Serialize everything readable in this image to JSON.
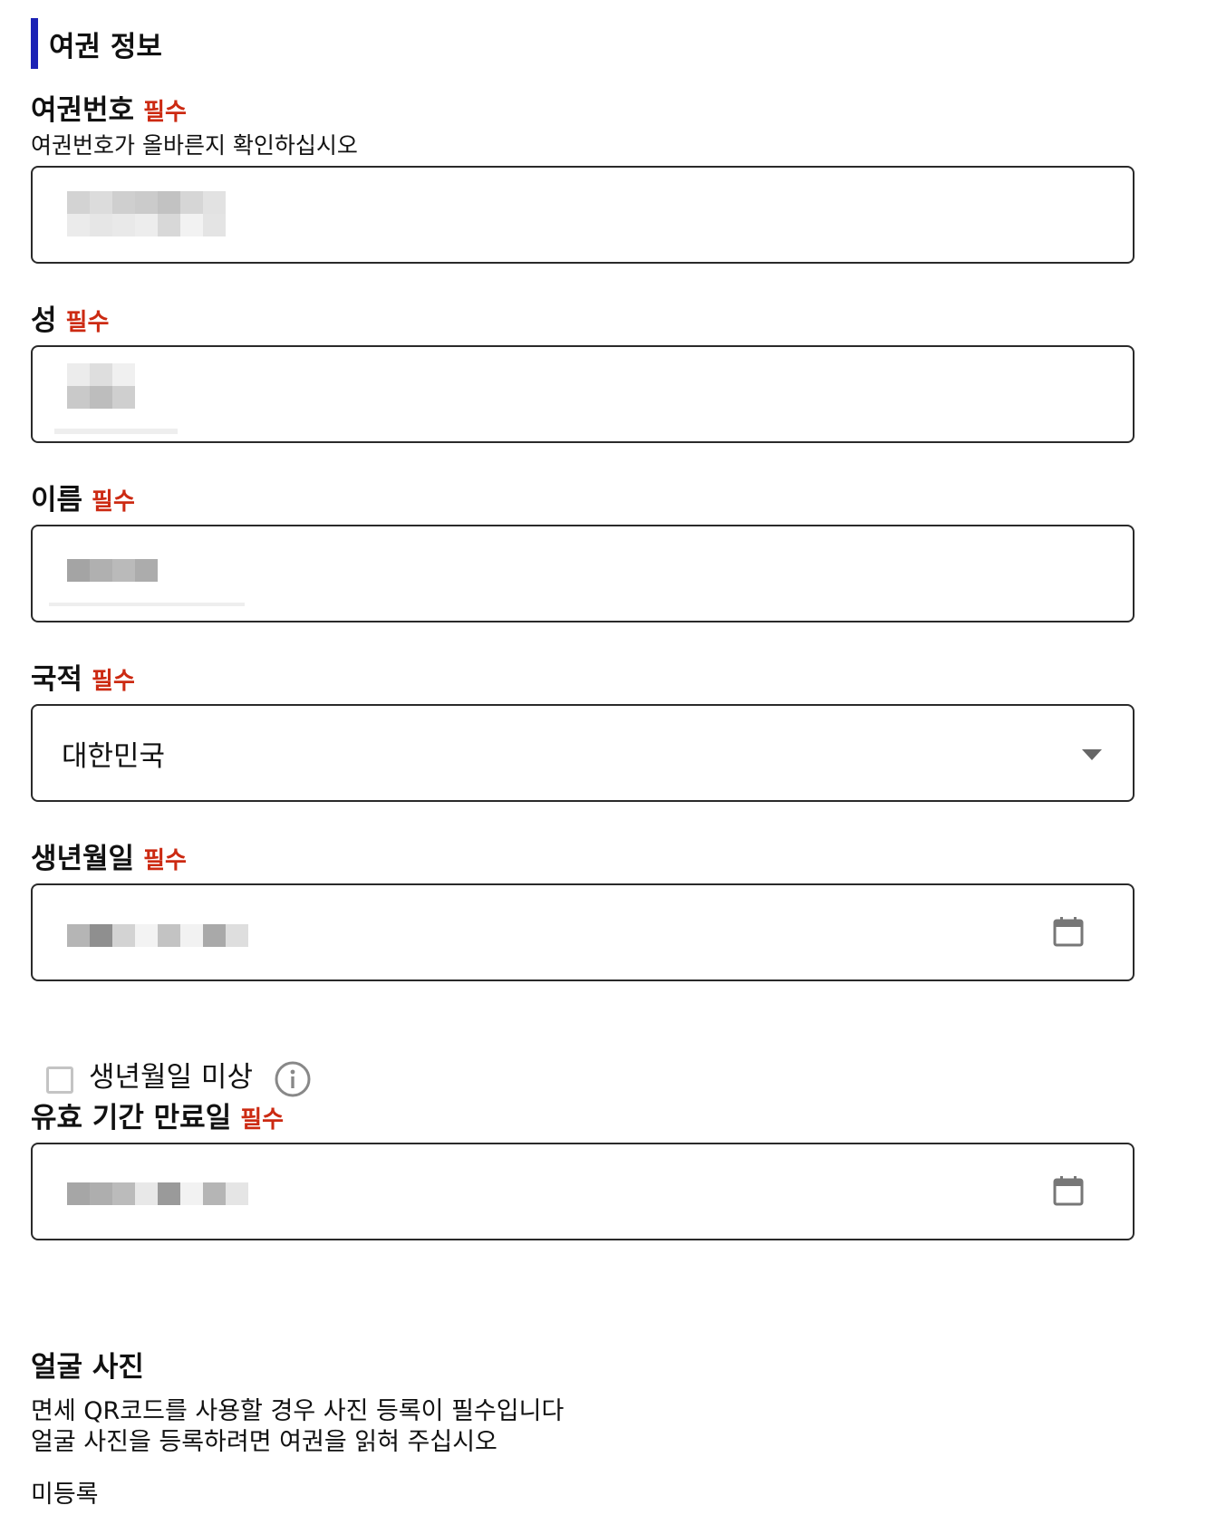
{
  "section": {
    "title": "여권 정보"
  },
  "required_tag": "필수",
  "passport_number": {
    "label": "여권번호",
    "hint": "여권번호가 올바른지 확인하십시오"
  },
  "surname": {
    "label": "성"
  },
  "given_name": {
    "label": "이름"
  },
  "nationality": {
    "label": "국적",
    "selected": "대한민국"
  },
  "birth_date": {
    "label": "생년월일",
    "unknown_checkbox_label": "생년월일 미상",
    "unknown_checked": false
  },
  "expiry_date": {
    "label": "유효 기간 만료일"
  },
  "face_photo": {
    "title": "얼굴 사진",
    "description_line1": "면세 QR코드를 사용할 경우 사진 등록이 필수입니다",
    "description_line2": "얼굴 사진을 등록하려면 여권을 읽혀 주십시오",
    "status": "미등록"
  },
  "colors": {
    "accent_bar": "#1b22b5",
    "required": "#cc2a12",
    "field_border": "#2a2a2a"
  },
  "icons": {
    "dropdown": "chevron-down-icon",
    "calendar": "calendar-icon",
    "info": "info-icon"
  }
}
